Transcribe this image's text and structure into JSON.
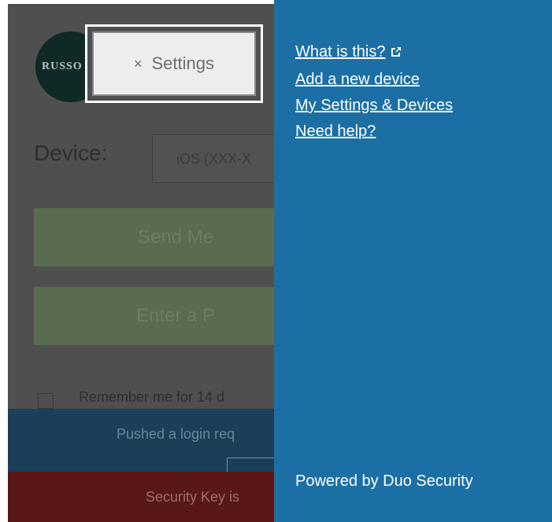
{
  "background": {
    "logo_text": "RUSSO",
    "device_label": "Device:",
    "device_value": "iOS (XXX-X",
    "send_button_label": "Send Me",
    "enter_button_label": "Enter a P",
    "remember_label": "Remember me for 14 d",
    "status_text": "Pushed a login req",
    "error_text": "Security Key is"
  },
  "settings_button": {
    "close_glyph": "×",
    "label": "Settings"
  },
  "panel": {
    "links": [
      {
        "label": "What is this?",
        "icon": "external-link-icon"
      },
      {
        "label": "Add a new device"
      },
      {
        "label": "My Settings & Devices"
      },
      {
        "label": "Need help?"
      }
    ],
    "powered_by": "Powered by Duo Security"
  },
  "colors": {
    "panel_bg": "#1c6fa5",
    "overlay_bg": "#4f4f4f",
    "status_bar": "#1b3e59",
    "error_bar": "#5a1717"
  }
}
